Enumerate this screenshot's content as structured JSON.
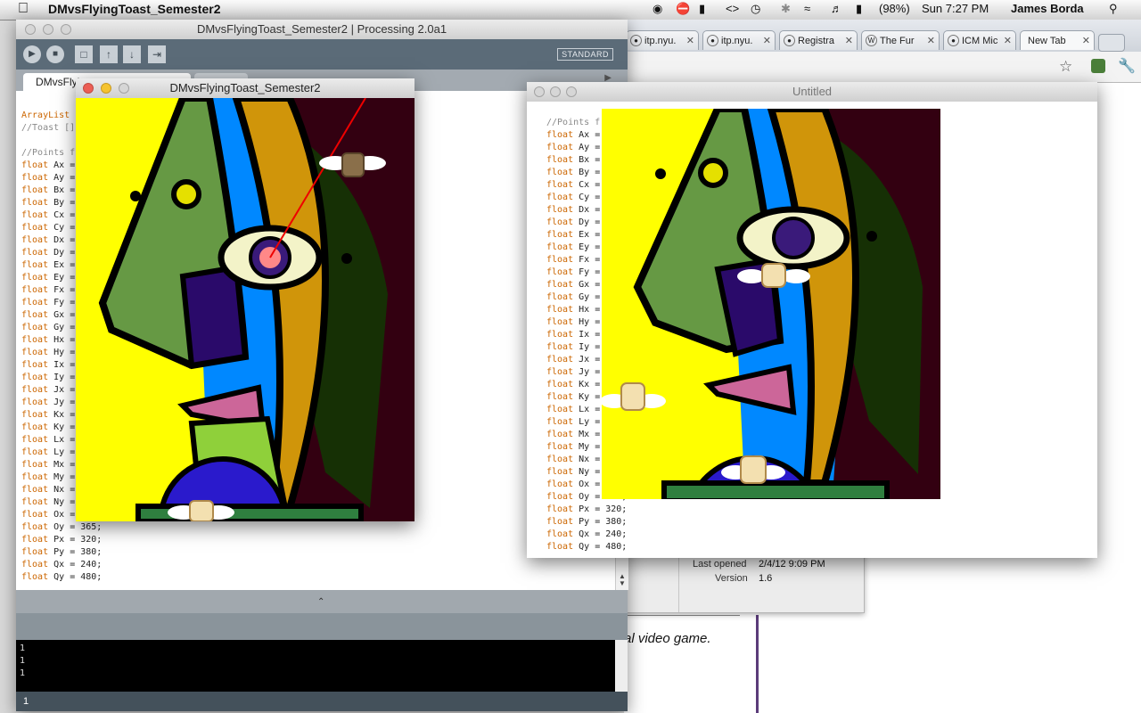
{
  "menubar": {
    "apple": "",
    "app_name": "DMvsFlyingToast_Semester2",
    "battery": "(98%)",
    "clock": "Sun 7:27 PM",
    "user": "James Borda"
  },
  "browser": {
    "tabs": [
      {
        "label": "itp.nyu."
      },
      {
        "label": "itp.nyu."
      },
      {
        "label": "Registra"
      },
      {
        "label": "The Fur"
      },
      {
        "label": "ICM Mic"
      },
      {
        "label": "New Tab"
      }
    ],
    "italic_text": "al video game.",
    "info_panel": {
      "last_opened_label": "Last opened",
      "last_opened_value": "2/4/12 9:09 PM",
      "version_label": "Version",
      "version_value": "1.6"
    }
  },
  "processing": {
    "window_title": "DMvsFlyingToast_Semester2 | Processing 2.0a1",
    "mode": "STANDARD",
    "tab_label": "DMvsFlyi",
    "code_lines": [
      {
        "kw": "ArrayList",
        "rest": ""
      },
      {
        "kw": "",
        "rest": "//Toast []",
        "comment": true
      },
      {
        "kw": "",
        "rest": ""
      },
      {
        "kw": "",
        "rest": "//Points f",
        "comment": true
      },
      {
        "kw": "float",
        "rest": " Ax ="
      },
      {
        "kw": "float",
        "rest": " Ay ="
      },
      {
        "kw": "float",
        "rest": " Bx ="
      },
      {
        "kw": "float",
        "rest": " By ="
      },
      {
        "kw": "float",
        "rest": " Cx ="
      },
      {
        "kw": "float",
        "rest": " Cy ="
      },
      {
        "kw": "float",
        "rest": " Dx ="
      },
      {
        "kw": "float",
        "rest": " Dy ="
      },
      {
        "kw": "float",
        "rest": " Ex ="
      },
      {
        "kw": "float",
        "rest": " Ey ="
      },
      {
        "kw": "float",
        "rest": " Fx ="
      },
      {
        "kw": "float",
        "rest": " Fy ="
      },
      {
        "kw": "float",
        "rest": " Gx ="
      },
      {
        "kw": "float",
        "rest": " Gy ="
      },
      {
        "kw": "float",
        "rest": " Hx ="
      },
      {
        "kw": "float",
        "rest": " Hy ="
      },
      {
        "kw": "float",
        "rest": " Ix ="
      },
      {
        "kw": "float",
        "rest": " Iy ="
      },
      {
        "kw": "float",
        "rest": " Jx ="
      },
      {
        "kw": "float",
        "rest": " Jy ="
      },
      {
        "kw": "float",
        "rest": " Kx ="
      },
      {
        "kw": "float",
        "rest": " Ky ="
      },
      {
        "kw": "float",
        "rest": " Lx ="
      },
      {
        "kw": "float",
        "rest": " Ly ="
      },
      {
        "kw": "float",
        "rest": " Mx ="
      },
      {
        "kw": "float",
        "rest": " My ="
      },
      {
        "kw": "float",
        "rest": " Nx ="
      },
      {
        "kw": "float",
        "rest": " Ny ="
      },
      {
        "kw": "float",
        "rest": " Ox ="
      },
      {
        "kw": "float",
        "rest": " Oy = 365;"
      },
      {
        "kw": "float",
        "rest": " Px = 320;"
      },
      {
        "kw": "float",
        "rest": " Py = 380;"
      },
      {
        "kw": "float",
        "rest": " Qx = 240;"
      },
      {
        "kw": "float",
        "rest": " Qy = 480;"
      }
    ],
    "console_lines": [
      "1",
      "1",
      "1"
    ],
    "status_line": "1"
  },
  "sketch_window": {
    "title": "DMvsFlyingToast_Semester2"
  },
  "untitled_window": {
    "title": "Untitled",
    "code_lines": [
      {
        "kw": "",
        "rest": "",
        "comment": false
      },
      {
        "kw": "",
        "rest": "//Points f",
        "comment": true
      },
      {
        "kw": "float",
        "rest": " Ax ="
      },
      {
        "kw": "float",
        "rest": " Ay ="
      },
      {
        "kw": "float",
        "rest": " Bx ="
      },
      {
        "kw": "float",
        "rest": " By ="
      },
      {
        "kw": "float",
        "rest": " Cx ="
      },
      {
        "kw": "float",
        "rest": " Cy ="
      },
      {
        "kw": "float",
        "rest": " Dx ="
      },
      {
        "kw": "float",
        "rest": " Dy ="
      },
      {
        "kw": "float",
        "rest": " Ex ="
      },
      {
        "kw": "float",
        "rest": " Ey ="
      },
      {
        "kw": "float",
        "rest": " Fx ="
      },
      {
        "kw": "float",
        "rest": " Fy ="
      },
      {
        "kw": "float",
        "rest": " Gx ="
      },
      {
        "kw": "float",
        "rest": " Gy ="
      },
      {
        "kw": "float",
        "rest": " Hx ="
      },
      {
        "kw": "float",
        "rest": " Hy ="
      },
      {
        "kw": "float",
        "rest": " Ix ="
      },
      {
        "kw": "float",
        "rest": " Iy ="
      },
      {
        "kw": "float",
        "rest": " Jx ="
      },
      {
        "kw": "float",
        "rest": " Jy ="
      },
      {
        "kw": "float",
        "rest": " Kx ="
      },
      {
        "kw": "float",
        "rest": " Ky ="
      },
      {
        "kw": "float",
        "rest": " Lx ="
      },
      {
        "kw": "float",
        "rest": " Ly ="
      },
      {
        "kw": "float",
        "rest": " Mx ="
      },
      {
        "kw": "float",
        "rest": " My ="
      },
      {
        "kw": "float",
        "rest": " Nx ="
      },
      {
        "kw": "float",
        "rest": " Ny ="
      },
      {
        "kw": "float",
        "rest": " Ox ="
      },
      {
        "kw": "float",
        "rest": " Oy = 365;"
      },
      {
        "kw": "float",
        "rest": " Px = 320;"
      },
      {
        "kw": "float",
        "rest": " Py = 380;"
      },
      {
        "kw": "float",
        "rest": " Qx = 240;"
      },
      {
        "kw": "float",
        "rest": " Qy = 480;"
      }
    ]
  },
  "colors": {
    "keyword": "#cc6600",
    "toolbar": "#5b6b78",
    "sketch_yellow": "#ffff00",
    "sketch_background": "#330011"
  }
}
